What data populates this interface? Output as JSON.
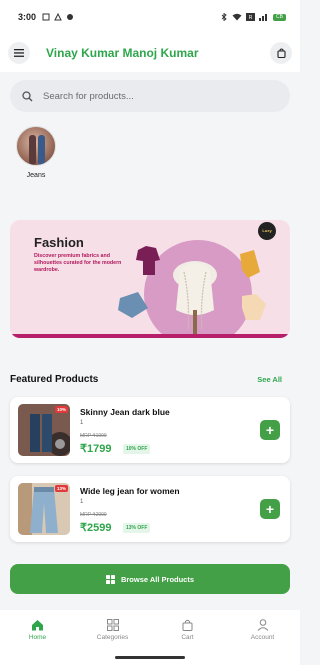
{
  "status": {
    "time": "3:00",
    "battery": "CB"
  },
  "header": {
    "title": "Vinay Kumar Manoj Kumar"
  },
  "search": {
    "placeholder": "Search for products..."
  },
  "categories": [
    {
      "label": "Jeans"
    }
  ],
  "banner": {
    "title": "Fashion",
    "subtitle": "Discover premium fabrics and silhouettes curated for the modern wardrobe.",
    "logo_text": "Luxy"
  },
  "featured": {
    "heading": "Featured Products",
    "see_all": "See All",
    "products": [
      {
        "name": "Skinny Jean dark blue",
        "qty": "1",
        "mrp": "MRP ₹1999",
        "price": "₹1799",
        "off": "10% OFF",
        "badge": "10%"
      },
      {
        "name": "Wide leg jean for women",
        "qty": "1",
        "mrp": "MRP ₹2999",
        "price": "₹2599",
        "off": "13% OFF",
        "badge": "13%"
      }
    ]
  },
  "browse_label": "Browse All Products",
  "tabs": [
    {
      "label": "Home",
      "icon": "home-icon",
      "active": true
    },
    {
      "label": "Categories",
      "icon": "grid-icon",
      "active": false
    },
    {
      "label": "Cart",
      "icon": "cart-icon",
      "active": false
    },
    {
      "label": "Account",
      "icon": "person-icon",
      "active": false
    }
  ],
  "colors": {
    "accent": "#2fa64c",
    "button": "#43a047",
    "banner_bg": "#f6dfe6",
    "discount_badge": "#e03a3a"
  }
}
